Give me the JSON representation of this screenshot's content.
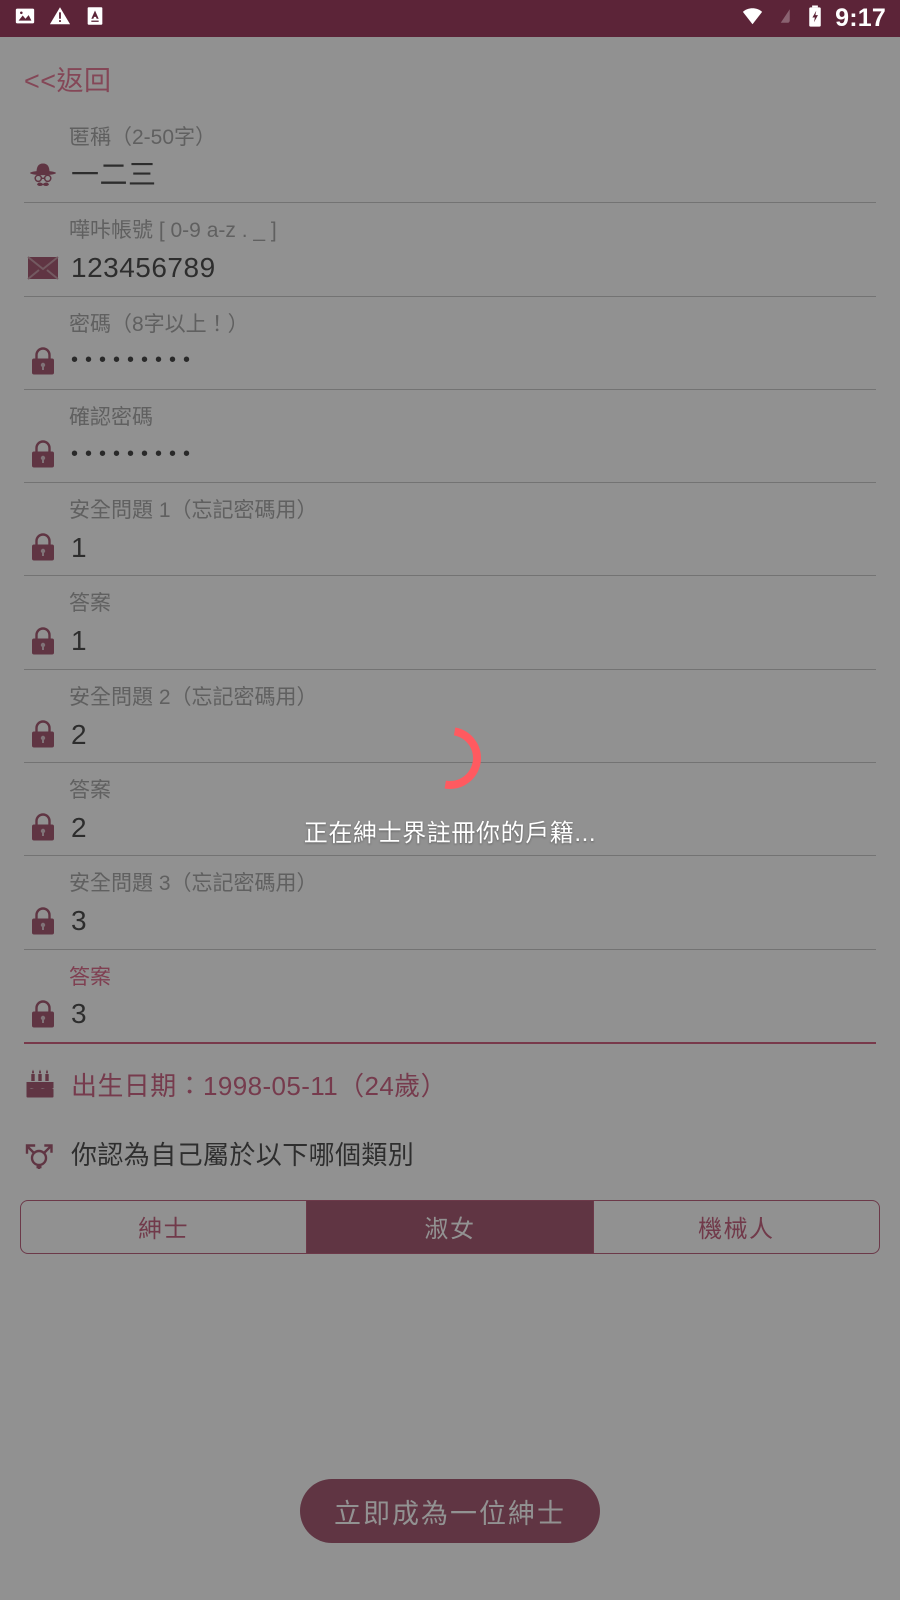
{
  "status_bar": {
    "icons": [
      "image-icon",
      "warning-triangle-icon",
      "font-a-icon"
    ],
    "wifi": "wifi-icon",
    "signal": "no-signal-icon",
    "battery": "battery-charging-icon",
    "clock": "9:17",
    "background_color": "#5c2438"
  },
  "nav": {
    "back_label": "<<返回"
  },
  "theme": {
    "accent": "#8e2d4c",
    "accent_light": "#c4365f",
    "spinner": "#ff5a60",
    "label_gray": "#8d8d8d"
  },
  "form": {
    "fields": [
      {
        "label": "匿稱（2-50字）",
        "value": "一二三",
        "icon": "gentleman-icon",
        "type": "text",
        "focused": false
      },
      {
        "label": "嘩咔帳號 [ 0-9 a-z . _ ]",
        "value": "123456789",
        "icon": "envelope-icon",
        "type": "text",
        "focused": false
      },
      {
        "label": "密碼（8字以上！）",
        "value": "•••••••••",
        "icon": "lock-icon",
        "type": "password",
        "focused": false
      },
      {
        "label": "確認密碼",
        "value": "•••••••••",
        "icon": "lock-icon",
        "type": "password",
        "focused": false
      },
      {
        "label": "安全問題 1（忘記密碼用）",
        "value": "1",
        "icon": "lock-icon",
        "type": "text",
        "focused": false
      },
      {
        "label": "答案",
        "value": "1",
        "icon": "lock-icon",
        "type": "text",
        "focused": false
      },
      {
        "label": "安全問題 2（忘記密碼用）",
        "value": "2",
        "icon": "lock-icon",
        "type": "text",
        "focused": false
      },
      {
        "label": "答案",
        "value": "2",
        "icon": "lock-icon",
        "type": "text",
        "focused": false
      },
      {
        "label": "安全問題 3（忘記密碼用）",
        "value": "3",
        "icon": "lock-icon",
        "type": "text",
        "focused": false
      },
      {
        "label": "答案",
        "value": "3",
        "icon": "lock-icon",
        "type": "text",
        "focused": true
      }
    ]
  },
  "birthday": {
    "icon": "birthday-cake-icon",
    "text": "出生日期：1998-05-11（24歲）"
  },
  "gender": {
    "icon": "transgender-icon",
    "question": "你認為自己屬於以下哪個類別",
    "options": [
      {
        "label": "紳士",
        "selected": false
      },
      {
        "label": "淑女",
        "selected": true
      },
      {
        "label": "機械人",
        "selected": false
      }
    ]
  },
  "submit": {
    "label": "立即成為一位紳士"
  },
  "overlay": {
    "loading_text": "正在紳士界註冊你的戶籍...",
    "spinner": "loading-spinner"
  }
}
